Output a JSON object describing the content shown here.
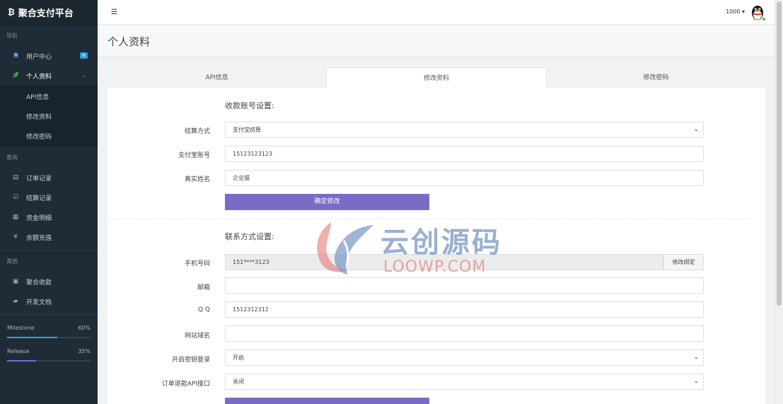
{
  "brand": {
    "logo": "₿",
    "title": "聚合支付平台"
  },
  "sidebar": {
    "section_nav": "导航",
    "home": {
      "label": "用户中心",
      "badge": "N",
      "icon": "home-icon"
    },
    "profile": {
      "label": "个人资料",
      "caret": "⌄",
      "icon": "leaf-icon"
    },
    "profile_sub": [
      "API信息",
      "修改资料",
      "修改密码"
    ],
    "section_query": "查询",
    "query_items": [
      {
        "label": "订单记录",
        "glyph": "▤",
        "icon": "list-icon"
      },
      {
        "label": "结算记录",
        "glyph": "☑",
        "icon": "checkbox-icon"
      },
      {
        "label": "资金明细",
        "glyph": "▦",
        "icon": "calendar-icon"
      },
      {
        "label": "余额充值",
        "glyph": "¥",
        "icon": "yen-icon"
      }
    ],
    "section_other": "其他",
    "other_items": [
      {
        "label": "聚合收款",
        "glyph": "▣",
        "icon": "qrcode-icon"
      },
      {
        "label": "开发文档",
        "glyph": "▰",
        "icon": "book-icon"
      }
    ],
    "progress": [
      {
        "label": "Milestone",
        "percent_text": "60%",
        "value": 0.6,
        "color": "#27a9e1"
      },
      {
        "label": "Release",
        "percent_text": "35%",
        "value": 0.35,
        "color": "#7a6cc6"
      }
    ]
  },
  "topbar": {
    "menu_toggle": "☰",
    "user_label": "1000 ▾"
  },
  "page": {
    "title": "个人资料"
  },
  "tabs": [
    "API信息",
    "修改资料",
    "修改密码"
  ],
  "payout": {
    "title": "收款账号设置:",
    "method_label": "结算方式",
    "method_value": "支付宝结算",
    "account_label": "支付宝账号",
    "account_value": "15123123123",
    "name_label": "真实姓名",
    "name_value": "企业猫",
    "submit": "确定修改"
  },
  "contact": {
    "title": "联系方式设置:",
    "phone_label": "手机号码",
    "phone_value": "151****3123",
    "phone_button": "修改绑定",
    "email_label": "邮箱",
    "email_value": "",
    "qq_label": "Q Q",
    "qq_value": "1512312312",
    "site_label": "网站域名",
    "site_value": "",
    "key_login_label": "开启密钥登录",
    "key_login_value": "开启",
    "refund_label": "订单退款API接口",
    "refund_value": "关闭"
  },
  "watermark": {
    "line1": "云创源码",
    "line2": "LOOWP.COM"
  }
}
